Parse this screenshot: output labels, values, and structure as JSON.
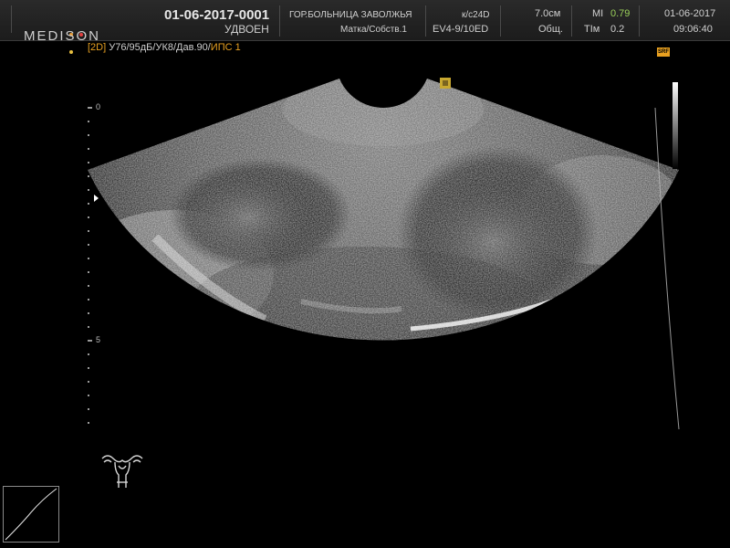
{
  "header": {
    "brand": "MEDISON",
    "brand_dot_colors": [
      "#e89a30",
      "#e04040",
      "#e8c040"
    ],
    "patient_id": "01-06-2017-0001",
    "mode_label": "УДВОЕН",
    "hospital": "ГОР.БОЛЬНИЦА ЗАВОЛЖЬЯ",
    "preset": "Матка/Собств.1",
    "frame_rate": "к/с24D",
    "probe": "EV4-9/10ED",
    "depth": "7.0см",
    "depth_mode": "Общ.",
    "mi_label": "MI",
    "mi_value": "0.79",
    "tim_label": "TIм",
    "tim_value": "0.2",
    "date": "01-06-2017",
    "time": "09:06:40"
  },
  "mode_line": {
    "mode": "[2D]",
    "params": "У76/95дБ/УК8/Дав.90/",
    "ips": "ИПС 1"
  },
  "scale": {
    "label_0": "0",
    "label_5": "5"
  },
  "icons": {
    "srf": "SRF",
    "srf_icon": "srf-icon",
    "orientation": "orientation-marker-icon",
    "uterus": "uterus-body-marker-icon",
    "gray_bar": "grayscale-bar",
    "curve": "gamma-curve-icon"
  },
  "colors": {
    "accent_orange": "#e8a020",
    "text_white": "#e6e6e6",
    "mi_green": "#9ad05a"
  }
}
